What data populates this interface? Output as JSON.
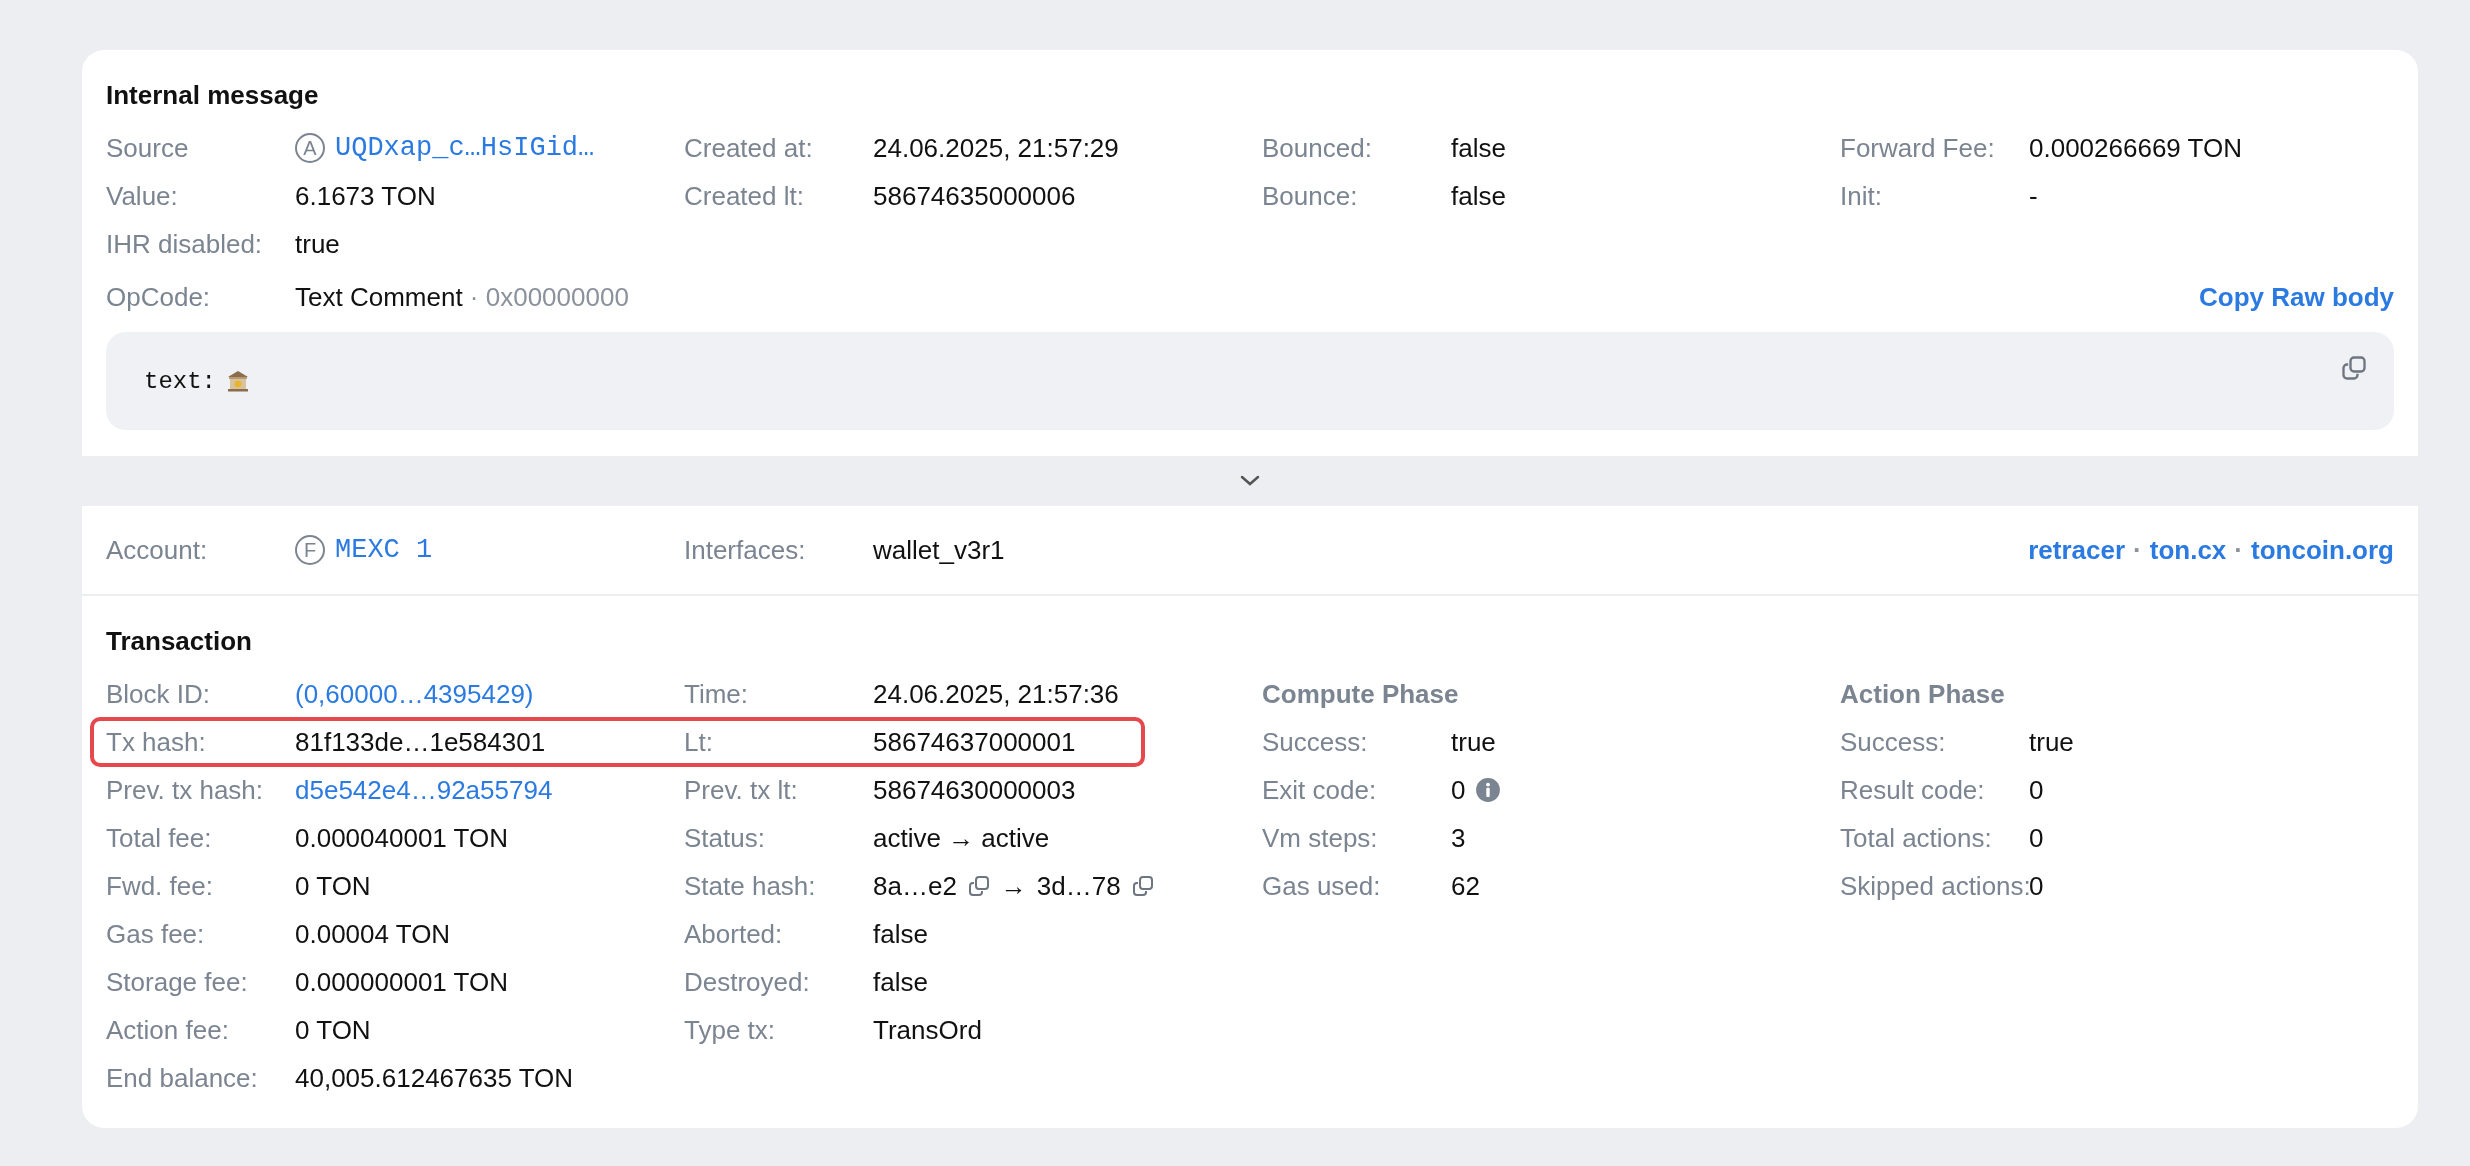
{
  "message": {
    "title": "Internal message",
    "columns": [
      {
        "fields": [
          {
            "label": "Source",
            "kind": "address",
            "badge": "A",
            "value": "UQDxap_c…HsIGid…"
          },
          {
            "label": "Value:",
            "kind": "text",
            "value": "6.1673 TON"
          },
          {
            "label": "IHR disabled:",
            "kind": "text",
            "value": "true"
          }
        ]
      },
      {
        "fields": [
          {
            "label": "Created at:",
            "kind": "text",
            "value": "24.06.2025, 21:57:29"
          },
          {
            "label": "Created lt:",
            "kind": "text",
            "value": "58674635000006"
          }
        ]
      },
      {
        "fields": [
          {
            "label": "Bounced:",
            "kind": "text",
            "value": "false"
          },
          {
            "label": "Bounce:",
            "kind": "text",
            "value": "false"
          }
        ]
      },
      {
        "fields": [
          {
            "label": "Forward Fee:",
            "kind": "text",
            "value": "0.000266669 TON"
          },
          {
            "label": "Init:",
            "kind": "text",
            "value": "-"
          }
        ]
      }
    ],
    "opcode": {
      "label": "OpCode:",
      "value": "Text Comment",
      "code": "· 0x00000000"
    },
    "copy_link": "Copy Raw body",
    "body": "text:"
  },
  "account": {
    "label": "Account:",
    "badge": "F",
    "value": "MEXC 1",
    "interfaces_label": "Interfaces:",
    "interfaces": "wallet_v3r1",
    "links": [
      "retracer",
      "ton.cx",
      "toncoin.org"
    ],
    "separator": "·"
  },
  "transaction": {
    "title": "Transaction",
    "columns": [
      {
        "fields": [
          {
            "label": "Block ID:",
            "kind": "link",
            "value": "(0,60000…4395429)",
            "highlighted": false
          },
          {
            "label": "Tx hash:",
            "kind": "text",
            "value": "81f133de…1e584301",
            "highlighted": true
          },
          {
            "label": "Prev. tx hash:",
            "kind": "link",
            "value": "d5e542e4…92a55794",
            "highlighted": false
          },
          {
            "label": "Total fee:",
            "kind": "text",
            "value": "0.000040001 TON",
            "highlighted": false
          },
          {
            "label": "Fwd. fee:",
            "kind": "text",
            "value": "0 TON",
            "highlighted": false
          },
          {
            "label": "Gas fee:",
            "kind": "text",
            "value": "0.00004 TON",
            "highlighted": false
          },
          {
            "label": "Storage fee:",
            "kind": "text",
            "value": "0.000000001 TON",
            "highlighted": false
          },
          {
            "label": "Action fee:",
            "kind": "text",
            "value": "0 TON",
            "highlighted": false
          },
          {
            "label": "End balance:",
            "kind": "text",
            "value": "40,005.612467635 TON",
            "highlighted": false
          }
        ]
      },
      {
        "fields": [
          {
            "label": "Time:",
            "kind": "text",
            "value": "24.06.2025, 21:57:36",
            "highlighted": false
          },
          {
            "label": "Lt:",
            "kind": "text",
            "value": "58674637000001",
            "highlighted": true
          },
          {
            "label": "Prev. tx lt:",
            "kind": "text",
            "value": "58674630000003",
            "highlighted": false
          },
          {
            "label": "Status:",
            "kind": "text",
            "value": "active → active",
            "highlighted": false
          },
          {
            "label": "State hash:",
            "kind": "hashes",
            "value": "8a…e2",
            "arrow": "→",
            "value_2": "3d…78",
            "highlighted": false
          },
          {
            "label": "Aborted:",
            "kind": "text",
            "value": "false",
            "highlighted": false
          },
          {
            "label": "Destroyed:",
            "kind": "text",
            "value": "false",
            "highlighted": false
          },
          {
            "label": "Type tx:",
            "kind": "text",
            "value": "TransOrd",
            "highlighted": false
          }
        ]
      },
      {
        "heading": "Compute Phase",
        "fields": [
          {
            "label": "Success:",
            "kind": "text",
            "value": "true",
            "highlighted": false
          },
          {
            "label": "Exit code:",
            "kind": "info",
            "value": "0",
            "highlighted": false
          },
          {
            "label": "Vm steps:",
            "kind": "text",
            "value": "3",
            "highlighted": false
          },
          {
            "label": "Gas used:",
            "kind": "text",
            "value": "62",
            "highlighted": false
          }
        ]
      },
      {
        "heading": "Action Phase",
        "fields": [
          {
            "label": "Success:",
            "kind": "text",
            "value": "true",
            "highlighted": false
          },
          {
            "label": "Result code:",
            "kind": "text",
            "value": "0",
            "highlighted": false
          },
          {
            "label": "Total actions:",
            "kind": "text",
            "value": "0",
            "highlighted": false
          },
          {
            "label": "Skipped actions:",
            "kind": "text",
            "value": "0",
            "highlighted": false
          }
        ]
      }
    ]
  }
}
